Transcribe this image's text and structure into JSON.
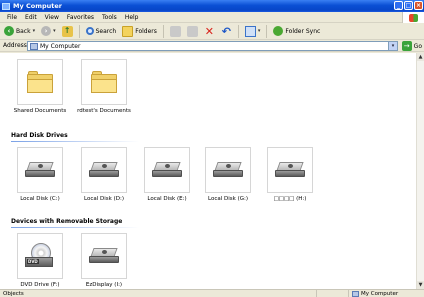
{
  "window": {
    "title": "My Computer",
    "controls": [
      "_",
      "□",
      "×"
    ]
  },
  "menu": [
    "File",
    "Edit",
    "View",
    "Favorites",
    "Tools",
    "Help"
  ],
  "toolbar": {
    "back_label": "Back",
    "search_label": "Search",
    "folders_label": "Folders",
    "folder_sync_label": "Folder Sync"
  },
  "address": {
    "label": "Address",
    "value": "My Computer",
    "go_label": "Go"
  },
  "sections": {
    "hard_disk_drives": "Hard Disk Drives",
    "removable_storage": "Devices with Removable Storage"
  },
  "folders": [
    {
      "label": "Shared Documents"
    },
    {
      "label": "rdtest's Documents"
    }
  ],
  "drives": [
    {
      "label": "Local Disk (C:)"
    },
    {
      "label": "Local Disk (D:)"
    },
    {
      "label": "Local Disk (E:)"
    },
    {
      "label": "Local Disk (G:)"
    },
    {
      "label": "□□□□ (H:)"
    }
  ],
  "removable": [
    {
      "label": "DVD Drive (F:)",
      "badge": "DVD"
    },
    {
      "label": "EzDisplay (I:)"
    }
  ],
  "status": {
    "left": "Objects",
    "right": "My Computer"
  }
}
